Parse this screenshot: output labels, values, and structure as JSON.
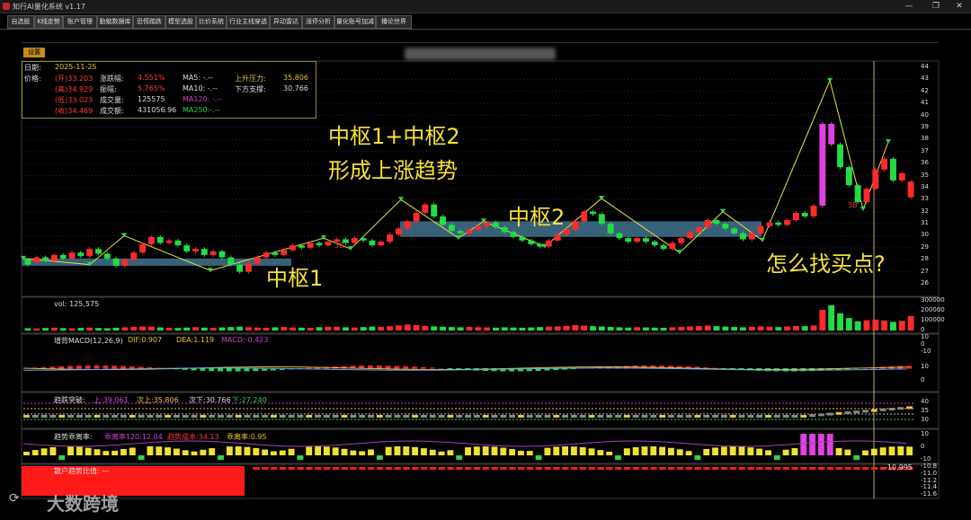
{
  "window": {
    "title": "知行AI量化系统 v1.17",
    "min": "—",
    "max": "❐",
    "close": "✕"
  },
  "tabs": [
    "自选股",
    "K线走势",
    "账户管理",
    "勤勉数据库",
    "恐慌踏跌",
    "模型选股",
    "比价系统",
    "行业主线穿透",
    "异动雷达",
    "涨停分析",
    "量化账号加减",
    "播论世界"
  ],
  "toolbar": {
    "settings": "设置"
  },
  "info": {
    "date_label": "日期:",
    "date": "2025-11-25",
    "price_label": "价格:",
    "open": "(开)33.203",
    "high": "(高)34.929",
    "low": "(低)33.023",
    "close": "(收)34.469",
    "chg_label": "涨跌幅:",
    "chg": "4.551%",
    "amp_label": "振幅:",
    "amp": "5.765%",
    "vol_label": "成交量:",
    "vol": "125575",
    "amt_label": "成交额:",
    "amt": "431056.96",
    "ma5": "MA5:  -.--",
    "ma10": "MA10:  -.--",
    "ma120": "MA120:  -.--",
    "ma250": "MA250:-.--",
    "up_label": "上升压力:",
    "up": "35.806",
    "down_label": "下方支撑:",
    "down": "30.766"
  },
  "overlays": {
    "t1": "中枢1+中枢2",
    "t2": "形成上涨趋势",
    "zs2": "中枢2",
    "zs1": "中枢1",
    "ask": "怎么找买点?",
    "b1": "3B",
    "b2": "3B"
  },
  "panels": {
    "vol": "vol: 125,575",
    "macd": "增背MACD(12,26,9)",
    "macd_dif": "DIF:0.907",
    "macd_dea": "DEA:1.119",
    "macd_macd": "MACD:-0.423",
    "trend": "趋跌突破:",
    "trend_up": "上:39.061",
    "trend_up2": "次上:35.806",
    "trend_dn": "次下:30.766",
    "trend_dn2": "下:27.240",
    "ratio": "趋势乖离率:",
    "ratio_a": "乖离率120:12.04",
    "ratio_b": "趋势成本:34.13",
    "ratio_c": "乖离率:0.95",
    "acct": "散户趋势比值: —",
    "acct_val": "-10.995"
  },
  "price_axis": [
    "44",
    "43",
    "42",
    "41",
    "40",
    "39",
    "38",
    "37",
    "36",
    "35",
    "34",
    "33",
    "32",
    "31",
    "30",
    "29",
    "28",
    "27",
    "26"
  ],
  "vol_axis": [
    "300000",
    "200000",
    "100000",
    "0"
  ],
  "macd_axis": [
    "10",
    "0",
    "-10"
  ],
  "macd2_axis": [
    "10",
    "0"
  ],
  "trend_axis": [
    "40",
    "35",
    "30"
  ],
  "ratio_axis": [
    "10",
    "0",
    "-10"
  ],
  "acct_axis": [
    "-10.8",
    "-11.0",
    "-11.2",
    "-11.4",
    "-11.6"
  ],
  "watermark": "大数跨境",
  "colors": {
    "up": "#ff2a2a",
    "down": "#22dd44",
    "zone": "#3d6b86",
    "annot": "#f6e23a",
    "zigzag": "#e6e23a"
  },
  "chart_data": {
    "type": "candlestick",
    "ylim": [
      26,
      44
    ],
    "candles": [
      [
        28.0,
        27.6
      ],
      [
        27.8,
        28.2
      ],
      [
        28.2,
        27.9
      ],
      [
        27.9,
        28.4
      ],
      [
        28.4,
        28.1
      ],
      [
        28.1,
        28.6
      ],
      [
        28.6,
        28.3
      ],
      [
        28.3,
        28.9
      ],
      [
        28.9,
        28.5
      ],
      [
        28.5,
        28.1
      ],
      [
        28.1,
        27.5
      ],
      [
        27.5,
        28.0
      ],
      [
        28.0,
        28.6
      ],
      [
        28.6,
        29.3
      ],
      [
        29.3,
        29.9
      ],
      [
        29.9,
        29.4
      ],
      [
        29.4,
        29.6
      ],
      [
        29.6,
        29.2
      ],
      [
        29.2,
        28.7
      ],
      [
        28.7,
        28.9
      ],
      [
        28.9,
        28.4
      ],
      [
        28.4,
        28.7
      ],
      [
        28.7,
        28.2
      ],
      [
        28.2,
        27.6
      ],
      [
        27.6,
        27.0
      ],
      [
        27.0,
        27.7
      ],
      [
        27.7,
        28.2
      ],
      [
        28.2,
        28.6
      ],
      [
        28.6,
        28.4
      ],
      [
        28.4,
        28.8
      ],
      [
        28.8,
        29.2
      ],
      [
        29.2,
        29.0
      ],
      [
        29.0,
        29.4
      ],
      [
        29.4,
        29.2
      ],
      [
        29.2,
        29.5
      ],
      [
        29.5,
        29.7
      ],
      [
        29.7,
        29.4
      ],
      [
        29.4,
        29.8
      ],
      [
        29.8,
        29.6
      ],
      [
        29.6,
        29.2
      ],
      [
        29.2,
        29.5
      ],
      [
        29.5,
        30.1
      ],
      [
        30.1,
        30.6
      ],
      [
        30.6,
        31.2
      ],
      [
        31.2,
        31.9
      ],
      [
        31.9,
        32.6
      ],
      [
        32.6,
        31.6
      ],
      [
        31.6,
        30.9
      ],
      [
        30.9,
        30.4
      ],
      [
        30.4,
        30.2
      ],
      [
        30.2,
        30.5
      ],
      [
        30.5,
        30.8
      ],
      [
        30.8,
        31.1
      ],
      [
        31.1,
        30.7
      ],
      [
        30.7,
        30.3
      ],
      [
        30.3,
        29.9
      ],
      [
        29.9,
        29.6
      ],
      [
        29.6,
        29.3
      ],
      [
        29.3,
        29.1
      ],
      [
        29.1,
        29.6
      ],
      [
        29.6,
        30.1
      ],
      [
        30.1,
        30.5
      ],
      [
        30.5,
        31.2
      ],
      [
        31.2,
        32.0
      ],
      [
        32.0,
        31.8
      ],
      [
        31.8,
        31.0
      ],
      [
        31.0,
        30.2
      ],
      [
        30.2,
        29.8
      ],
      [
        29.8,
        29.5
      ],
      [
        29.5,
        29.8
      ],
      [
        29.8,
        29.5
      ],
      [
        29.5,
        29.2
      ],
      [
        29.2,
        28.9
      ],
      [
        28.9,
        29.4
      ],
      [
        29.4,
        29.8
      ],
      [
        29.8,
        30.3
      ],
      [
        30.3,
        30.7
      ],
      [
        30.7,
        31.3
      ],
      [
        31.3,
        31.0
      ],
      [
        31.0,
        30.6
      ],
      [
        30.6,
        30.2
      ],
      [
        30.2,
        29.7
      ],
      [
        29.7,
        30.2
      ],
      [
        30.2,
        30.8
      ],
      [
        30.8,
        31.1
      ],
      [
        31.1,
        30.9
      ],
      [
        30.9,
        31.3
      ],
      [
        31.3,
        31.9
      ],
      [
        31.9,
        31.6
      ],
      [
        31.6,
        32.5
      ],
      [
        32.5,
        39.3
      ],
      [
        39.3,
        37.6
      ],
      [
        37.6,
        35.7
      ],
      [
        35.7,
        34.2
      ],
      [
        34.2,
        32.8
      ],
      [
        32.8,
        33.9
      ],
      [
        33.9,
        35.5
      ],
      [
        35.5,
        36.4
      ],
      [
        36.4,
        34.6
      ],
      [
        34.6,
        35.2
      ],
      [
        33.2,
        34.5
      ]
    ],
    "volume": [
      20,
      18,
      22,
      25,
      21,
      19,
      23,
      26,
      22,
      20,
      24,
      28,
      31,
      35,
      33,
      27,
      24,
      22,
      26,
      29,
      25,
      23,
      27,
      30,
      33,
      29,
      26,
      24,
      28,
      31,
      27,
      25,
      23,
      29,
      33,
      31,
      28,
      26,
      30,
      34,
      32,
      38,
      45,
      52,
      48,
      40,
      36,
      33,
      30,
      28,
      31,
      29,
      27,
      25,
      28,
      26,
      24,
      27,
      30,
      34,
      36,
      41,
      47,
      43,
      38,
      35,
      31,
      28,
      26,
      29,
      27,
      25,
      24,
      28,
      32,
      36,
      40,
      44,
      38,
      34,
      31,
      28,
      32,
      36,
      33,
      30,
      35,
      40,
      38,
      44,
      180,
      220,
      150,
      110,
      80,
      90,
      95,
      88,
      76,
      85,
      126
    ]
  }
}
